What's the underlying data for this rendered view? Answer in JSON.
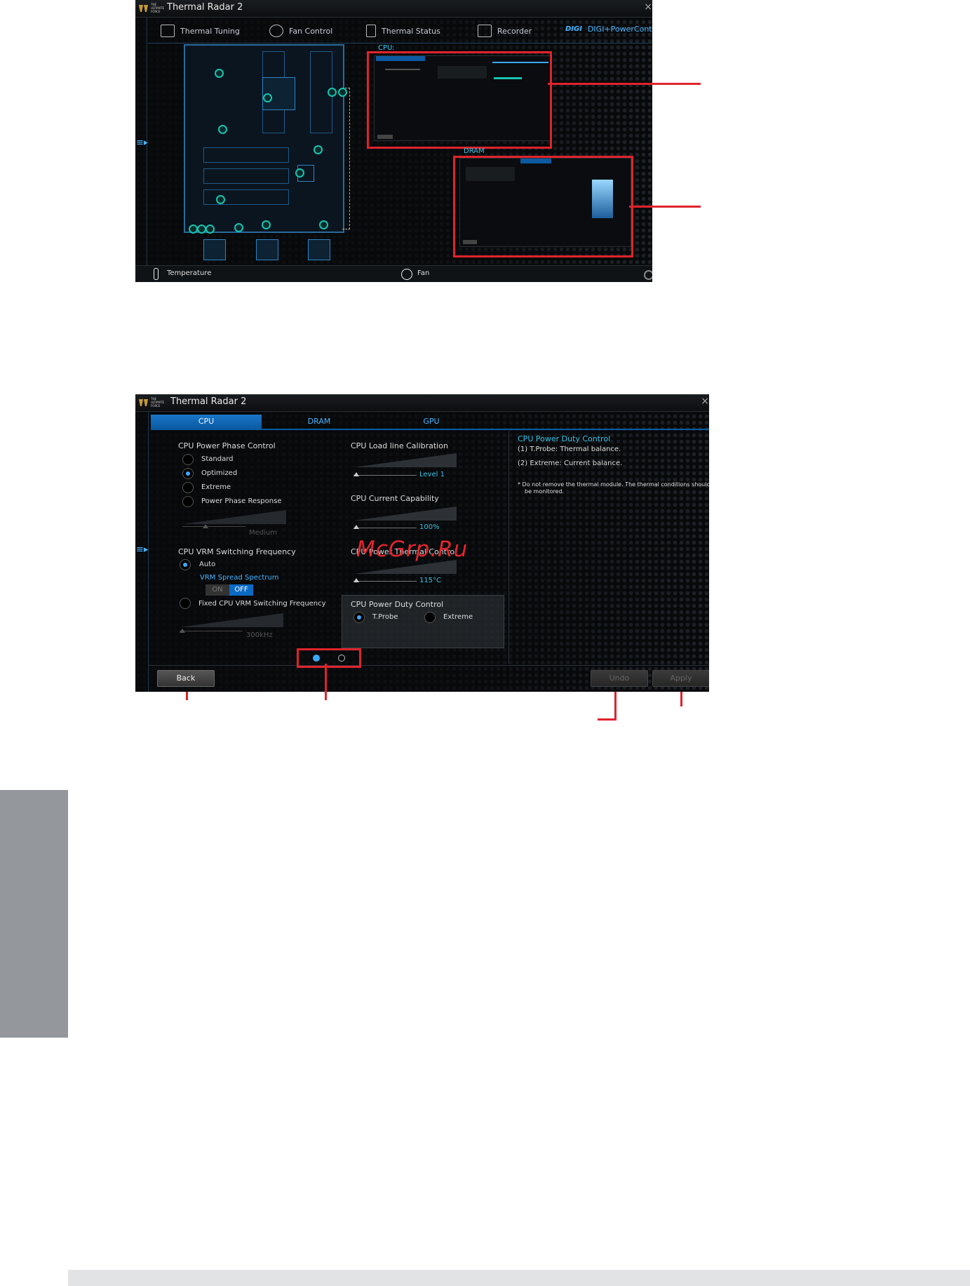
{
  "app": {
    "brand_lines": [
      "THE",
      "ULTIMATE",
      "FORCE"
    ],
    "title": "Thermal Radar 2",
    "close_glyph": "×"
  },
  "screen1": {
    "nav_tabs": [
      {
        "label": "Thermal Tuning",
        "icon": "thermal-tuning-icon"
      },
      {
        "label": "Fan Control",
        "icon": "fan-icon"
      },
      {
        "label": "Thermal Status",
        "icon": "document-icon"
      },
      {
        "label": "Recorder",
        "icon": "recorder-icon"
      },
      {
        "label": "DIGI+PowerControl",
        "icon": "digi-icon",
        "active": true
      }
    ],
    "cpu_callout": "CPU",
    "dram_callout": "DRAM",
    "bottom": {
      "temperature": "Temperature",
      "fan": "Fan"
    }
  },
  "screen2": {
    "tabs": [
      "CPU",
      "DRAM",
      "GPU"
    ],
    "power_phase": {
      "title": "CPU Power Phase Control",
      "options": [
        "Standard",
        "Optimized",
        "Extreme",
        "Power Phase Response"
      ],
      "selected": "Optimized",
      "slider_value": "Medium"
    },
    "vrm": {
      "title": "CPU VRM Switching Frequency",
      "auto_label": "Auto",
      "spread_label": "VRM Spread Spectrum",
      "toggle_on": "ON",
      "toggle_off": "OFF",
      "fixed_label": "Fixed CPU VRM Switching Frequency",
      "slider_value": "300kHz"
    },
    "llc": {
      "title": "CPU Load line Calibration",
      "value": "Level 1"
    },
    "current": {
      "title": "CPU Current Capability",
      "value": "100%"
    },
    "thermal": {
      "title": "CPU Power Thermal Control",
      "value": "115°C"
    },
    "duty": {
      "title": "CPU Power Duty Control",
      "options": [
        "T.Probe",
        "Extreme"
      ],
      "selected": "T.Probe"
    },
    "help": {
      "title": "CPU Power Duty Control",
      "line1": "(1) T.Probe: Thermal balance.",
      "line2": "(2) Extreme: Current balance.",
      "note_line1": "*  Do not remove the thermal module. The thermal conditions should",
      "note_line2": "be monitored."
    },
    "buttons": {
      "back": "Back",
      "undo": "Undo",
      "apply": "Apply"
    }
  },
  "watermark": "McGrp.Ru",
  "colors": {
    "accent": "#0b5aa2",
    "callout": "#e0232b",
    "sensor": "#19c3b0",
    "side_tab": "#94989c"
  }
}
